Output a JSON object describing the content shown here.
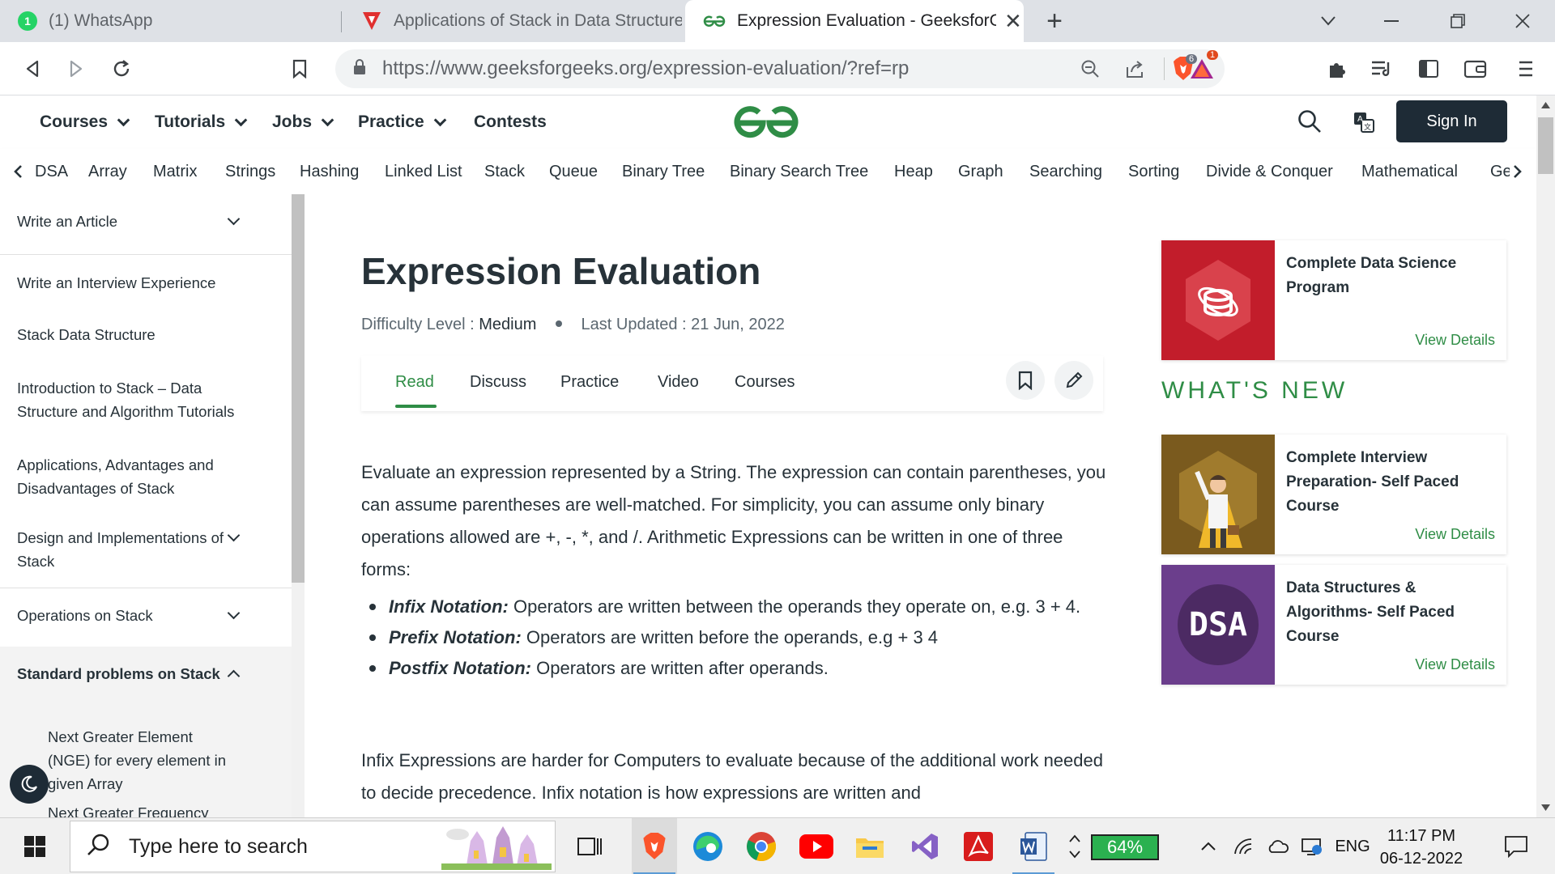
{
  "browser": {
    "tabs": [
      {
        "title": "(1) WhatsApp",
        "badge": "1"
      },
      {
        "title": "Applications of Stack in Data Structure"
      },
      {
        "title": "Expression Evaluation - GeeksforGeeks"
      }
    ],
    "new_tab": "+",
    "url": "https://www.geeksforgeeks.org/expression-evaluation/?ref=rp",
    "shield_count": "6",
    "rewards_count": "1"
  },
  "site": {
    "nav": [
      "Courses",
      "Tutorials",
      "Jobs",
      "Practice",
      "Contests"
    ],
    "signin": "Sign In",
    "topics": [
      "DSA",
      "Array",
      "Matrix",
      "Strings",
      "Hashing",
      "Linked List",
      "Stack",
      "Queue",
      "Binary Tree",
      "Binary Search Tree",
      "Heap",
      "Graph",
      "Searching",
      "Sorting",
      "Divide & Conquer",
      "Mathematical",
      "Ge"
    ]
  },
  "sidebar": {
    "items": [
      "Write an Article",
      "Write an Interview Experience",
      "Stack Data Structure",
      "Introduction to Stack – Data Structure and Algorithm Tutorials",
      "Applications, Advantages and Disadvantages of Stack",
      "Design and Implementations of Stack",
      "Operations on Stack",
      "Standard problems on Stack",
      "Next Greater Element (NGE) for every element in given Array",
      "Next Greater Frequency"
    ]
  },
  "article": {
    "title": "Expression Evaluation",
    "difficulty_label": "Difficulty Level :",
    "difficulty": "Medium",
    "updated": "Last Updated : 21 Jun, 2022",
    "tabs": [
      "Read",
      "Discuss",
      "Practice",
      "Video",
      "Courses"
    ],
    "para1": "Evaluate an expression represented by a String. The expression can contain parentheses, you can assume parentheses are well-matched. For simplicity, you can assume only binary operations allowed are +, -, *, and /. Arithmetic Expressions can be written in one of three forms:",
    "bullets": [
      {
        "term": "Infix Notation:",
        "text": " Operators are written between the operands they operate on, e.g. 3 + 4."
      },
      {
        "term": "Prefix Notation:",
        "text": " Operators are written before the operands, e.g + 3 4"
      },
      {
        "term": "Postfix Notation:",
        "text": " Operators are written after operands."
      }
    ],
    "para2": "Infix Expressions are harder for Computers to evaluate because of the additional work needed to decide precedence. Infix notation is how expressions are written and"
  },
  "rail": {
    "cards": [
      {
        "title": "Complete Data Science Program",
        "link": "View Details"
      },
      {
        "title": "Complete Interview Preparation- Self Paced Course",
        "link": "View Details"
      },
      {
        "title": "Data Structures & Algorithms- Self Paced Course",
        "link": "View Details",
        "img_text": "DSA"
      }
    ],
    "whats_new": "WHAT'S NEW"
  },
  "taskbar": {
    "search_placeholder": "Type here to search",
    "battery": "64%",
    "language": "ENG",
    "time": "11:17 PM",
    "date": "06-12-2022"
  },
  "colors": {
    "gfg_green": "#2f8d46",
    "signin_bg": "#1e2b36",
    "text": "#273239"
  }
}
